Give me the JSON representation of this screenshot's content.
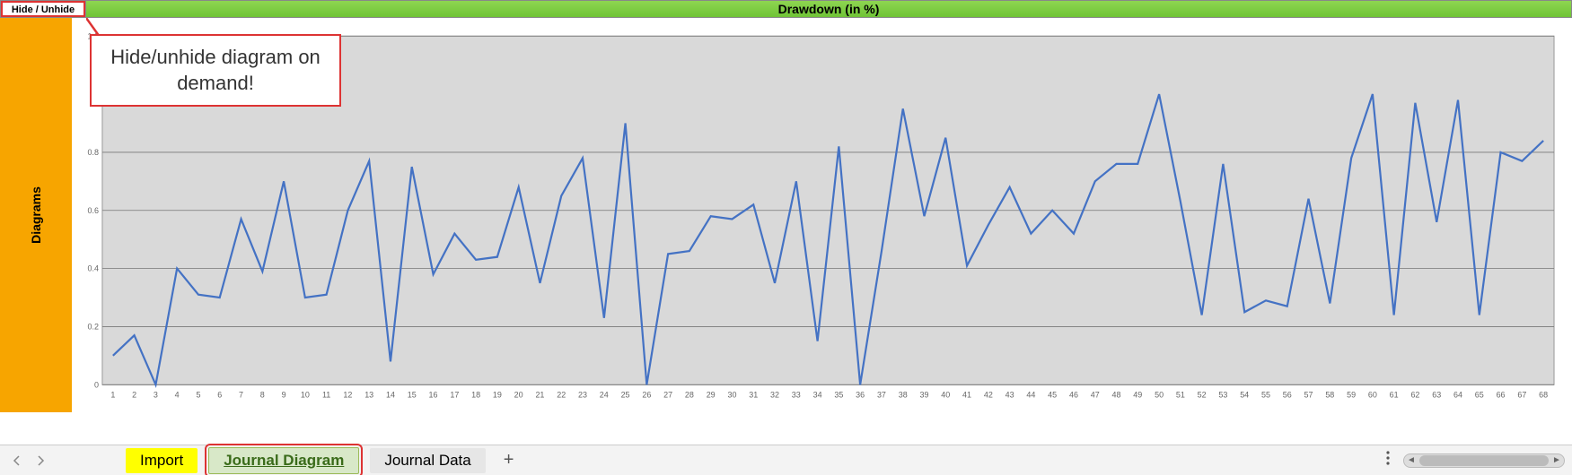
{
  "topbar": {
    "hide_btn": "Hide / Unhide",
    "title": "Drawdown (in %)"
  },
  "sidebar": {
    "label": "Diagrams"
  },
  "callout": {
    "text": "Hide/unhide diagram on demand!"
  },
  "tabs": {
    "import": "Import",
    "journal_diagram": "Journal Diagram",
    "journal_data": "Journal Data",
    "plus": "+"
  },
  "chart_data": {
    "type": "line",
    "title": "Drawdown (in %)",
    "xlabel": "",
    "ylabel": "",
    "ylim": [
      0,
      1.2
    ],
    "yticks": [
      0,
      0.2,
      0.4,
      0.6,
      0.8,
      1.2
    ],
    "categories": [
      1,
      2,
      3,
      4,
      5,
      6,
      7,
      8,
      9,
      10,
      11,
      12,
      13,
      14,
      15,
      16,
      17,
      18,
      19,
      20,
      21,
      22,
      23,
      24,
      25,
      26,
      27,
      28,
      29,
      30,
      31,
      32,
      33,
      34,
      35,
      36,
      37,
      38,
      39,
      40,
      41,
      42,
      43,
      44,
      45,
      46,
      47,
      48,
      49,
      50,
      51,
      52,
      53,
      54,
      55,
      56,
      57,
      58,
      59,
      60,
      61,
      62,
      63,
      64,
      65,
      66,
      67,
      68
    ],
    "values": [
      0.1,
      0.17,
      0.0,
      0.4,
      0.31,
      0.3,
      0.57,
      0.39,
      0.7,
      0.3,
      0.31,
      0.6,
      0.77,
      0.08,
      0.75,
      0.38,
      0.52,
      0.43,
      0.44,
      0.68,
      0.35,
      0.65,
      0.78,
      0.23,
      0.9,
      0.0,
      0.45,
      0.46,
      0.58,
      0.57,
      0.62,
      0.35,
      0.7,
      0.15,
      0.82,
      0.0,
      0.46,
      0.95,
      0.58,
      0.85,
      0.41,
      0.55,
      0.68,
      0.52,
      0.6,
      0.52,
      0.7,
      0.76,
      0.76,
      1.0,
      0.63,
      0.24,
      0.76,
      0.25,
      0.29,
      0.27,
      0.64,
      0.28,
      0.78,
      1.0,
      0.24,
      0.97,
      0.56,
      0.98,
      0.24,
      0.8,
      0.77,
      0.84
    ]
  }
}
